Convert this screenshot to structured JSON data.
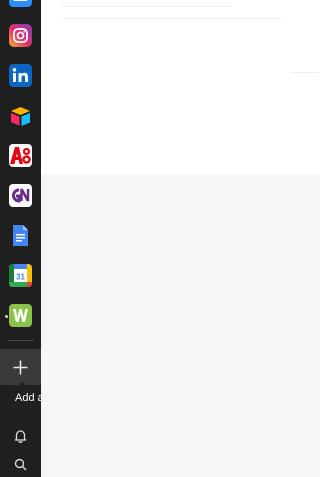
{
  "sidebar": {
    "apps": [
      {
        "icon": "instagram-icon",
        "color": "#e1306c"
      },
      {
        "icon": "linkedin-icon",
        "color": "#0a66c2"
      },
      {
        "icon": "airtable-icon",
        "color": "#fcb400"
      },
      {
        "icon": "a8-icon",
        "color": "#e30613"
      },
      {
        "icon": "gn-icon",
        "color": "#6a2c8a"
      },
      {
        "icon": "google-docs-icon",
        "color": "#4285f4"
      },
      {
        "icon": "google-calendar-icon",
        "color": "#4285f4"
      },
      {
        "icon": "w-app-icon",
        "color": "#8bc34a"
      }
    ],
    "add_button": {
      "icon": "plus-icon"
    },
    "tooltip": "Add application",
    "bottom_icons": [
      "bell-icon",
      "search-icon"
    ]
  },
  "colors": {
    "sidebar_bg": "#1f1f1f",
    "tooltip_bg": "#202020",
    "main_bg": "#f6f6f6"
  }
}
